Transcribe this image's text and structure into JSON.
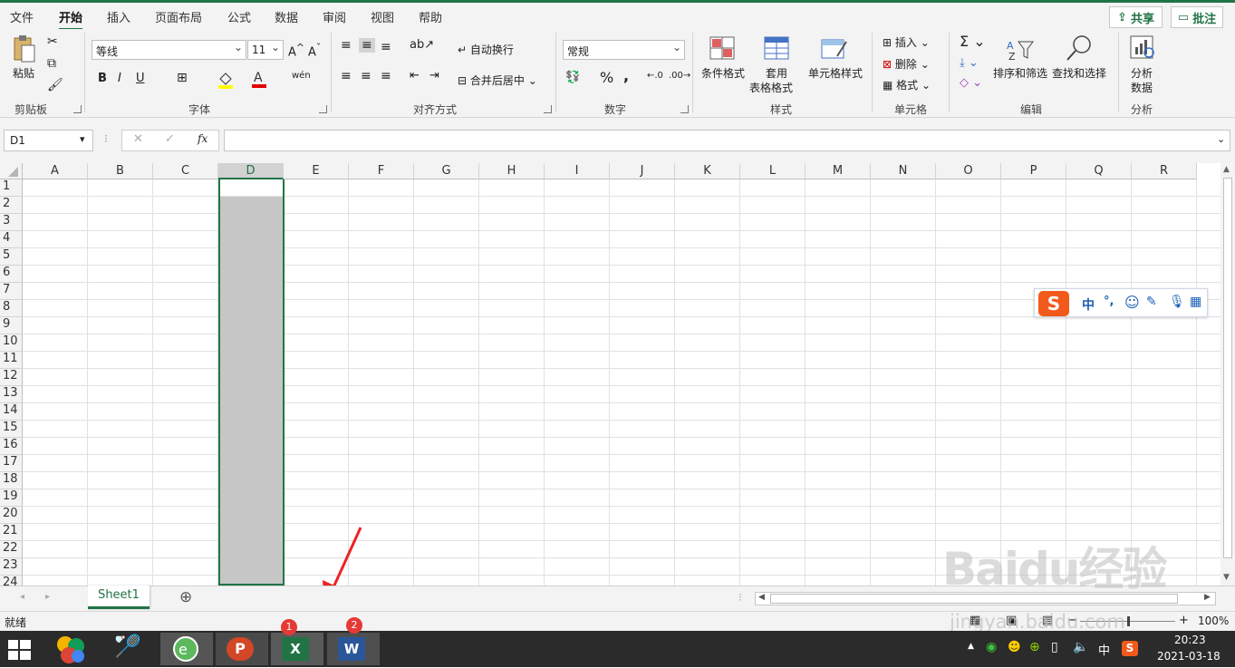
{
  "menu": {
    "tabs": [
      "文件",
      "开始",
      "插入",
      "页面布局",
      "公式",
      "数据",
      "审阅",
      "视图",
      "帮助"
    ],
    "active": "开始",
    "share": "共享",
    "comment": "批注"
  },
  "ribbon": {
    "clipboard": {
      "paste": "粘贴",
      "label": "剪贴板"
    },
    "font": {
      "name": "等线",
      "size": "11",
      "bold": "B",
      "italic": "I",
      "underline": "U",
      "grow": "A^",
      "shrink": "Aˇ",
      "label": "字体"
    },
    "align": {
      "wrap": "自动换行",
      "merge": "合并后居中",
      "label": "对齐方式"
    },
    "number": {
      "format": "常规",
      "percent": "%",
      "comma": ",",
      "label": "数字"
    },
    "styles": {
      "cond": "条件格式",
      "table1": "套用",
      "table2": "表格格式",
      "cell": "单元格样式",
      "label": "样式"
    },
    "cells": {
      "insert": "插入",
      "delete": "删除",
      "format": "格式",
      "label": "单元格"
    },
    "edit": {
      "sort": "排序和筛选",
      "find": "查找和选择",
      "label": "编辑"
    },
    "analysis": {
      "btn1": "分析",
      "btn2": "数据",
      "label": "分析"
    }
  },
  "formula": {
    "namebox": "D1",
    "fx": "fx",
    "cancel": "✕",
    "confirm": "✓"
  },
  "grid": {
    "columns": [
      "A",
      "B",
      "C",
      "D",
      "E",
      "F",
      "G",
      "H",
      "I",
      "J",
      "K",
      "L",
      "M",
      "N",
      "O",
      "P",
      "Q",
      "R"
    ],
    "rows": [
      "1",
      "2",
      "3",
      "4",
      "5",
      "6",
      "7",
      "8",
      "9",
      "10",
      "11",
      "12",
      "13",
      "14",
      "15",
      "16",
      "17",
      "18",
      "19",
      "20",
      "21",
      "22",
      "23",
      "24"
    ],
    "selected_column": "D"
  },
  "sheets": {
    "tabs": [
      "Sheet1"
    ],
    "add": "⊕"
  },
  "status": {
    "ready": "就绪",
    "zoom": "100%",
    "minus": "−",
    "plus": "+"
  },
  "ime": {
    "zhong": "中",
    "punct": "°,",
    "logo": "S"
  },
  "taskbar": {
    "time": "20:23",
    "date": "2021-03-18",
    "lang": "中",
    "badge1": "1",
    "badge2": "2",
    "excel": "X",
    "word": "W",
    "ppt": "P"
  },
  "watermark": {
    "text": "Baidu经验",
    "url": "jingyan.baidu.com"
  },
  "colors": {
    "excel_green": "#217346",
    "selection_gray": "#c6c6c6",
    "arrow_red": "#ee2222"
  }
}
